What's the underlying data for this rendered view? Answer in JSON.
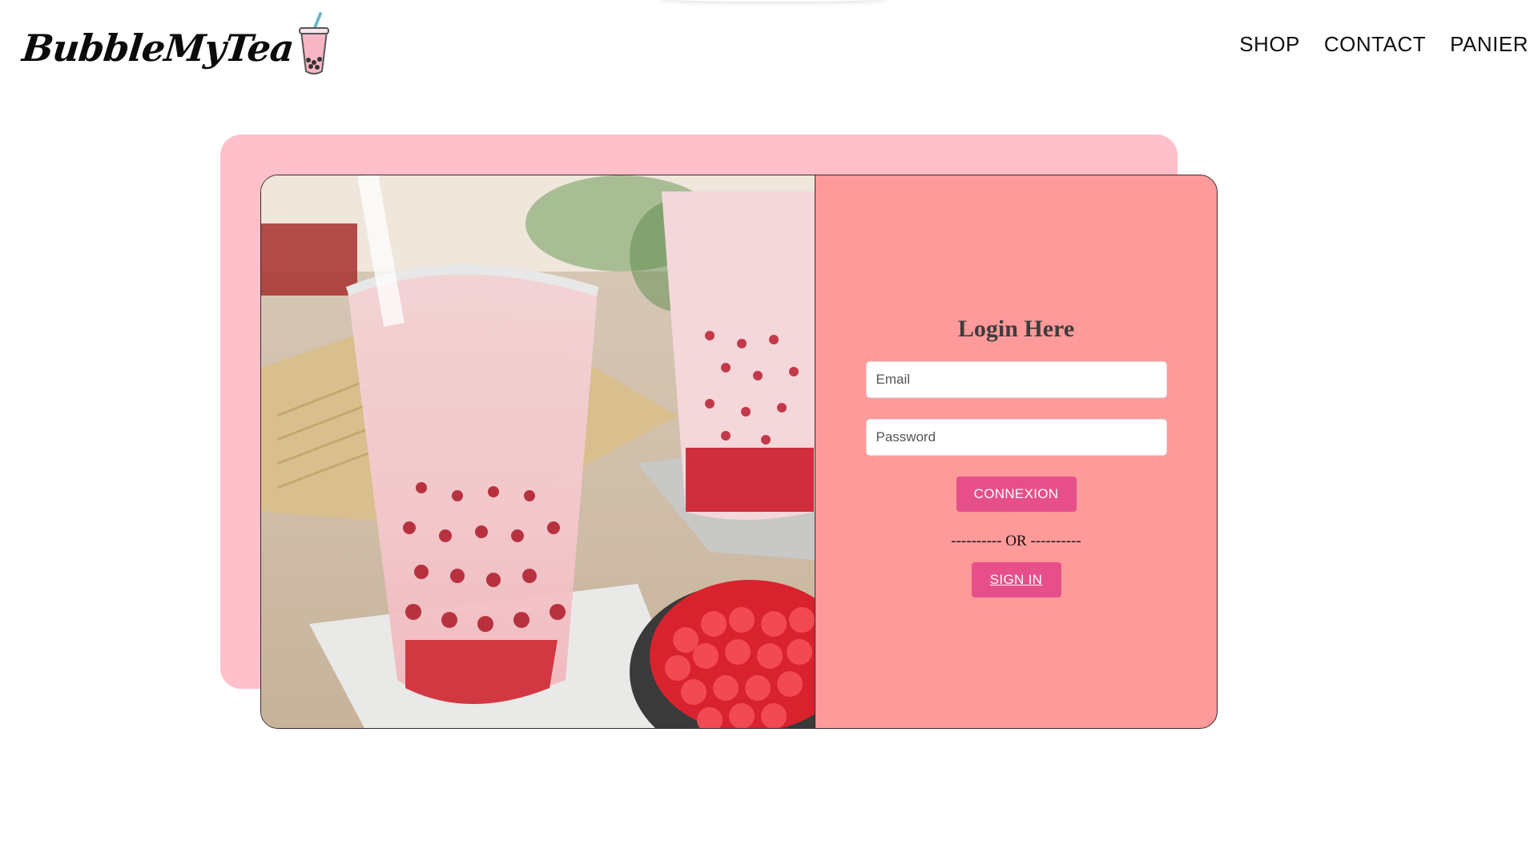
{
  "header": {
    "logo_text": "BubbleMyTea",
    "nav": [
      {
        "label": "SHOP"
      },
      {
        "label": "CONTACT"
      },
      {
        "label": "PANIER"
      }
    ]
  },
  "login": {
    "title": "Login Here",
    "email_placeholder": "Email",
    "password_placeholder": "Password",
    "connexion_label": "CONNEXION",
    "divider_text": "---------- OR ----------",
    "signin_label": "SIGN IN"
  },
  "colors": {
    "accent_button": "#e64f8a",
    "form_panel": "#ff9a9a",
    "back_card": "#ffc0cb"
  },
  "icons": {
    "logo_cup": "bubble-tea-cup-icon"
  }
}
